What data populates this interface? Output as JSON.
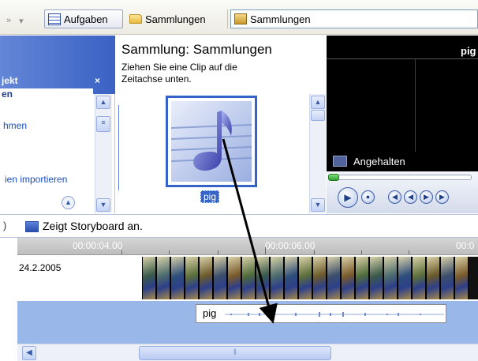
{
  "toolbar": {
    "back_glyph": "»",
    "tasks_label": "Aufgaben",
    "collections_label": "Sammlungen",
    "collection_combo_value": "Sammlungen",
    "tasks_icon": "task-list-icon",
    "collections_icon": "folder-icon",
    "combo_icon": "collection-icon"
  },
  "task_pane": {
    "header_title": "jekt",
    "close_glyph": "×",
    "panel_subtitle": "en",
    "link_1": "hmen",
    "link_2": "ien importieren"
  },
  "collection_pane": {
    "title": "Sammlung: Sammlungen",
    "hint": "Ziehen Sie eine Clip auf die Zeitachse unten.",
    "clip_label": "pig",
    "clip_icon": "music-note-icon"
  },
  "monitor": {
    "title": "pig",
    "status": "Angehalten"
  },
  "storyboard": {
    "left_edge": ")",
    "toggle_text": "Zeigt Storyboard an."
  },
  "timeline": {
    "ruler_labels": [
      "00:00:04.00",
      "00:00:06.00",
      "00:0"
    ],
    "video_date": "24.2.2005",
    "audio_clip_name": "pig"
  },
  "colors": {
    "accent": "#3563c8",
    "audio_track": "#9ab7ea",
    "monitor_bg": "#000000"
  }
}
